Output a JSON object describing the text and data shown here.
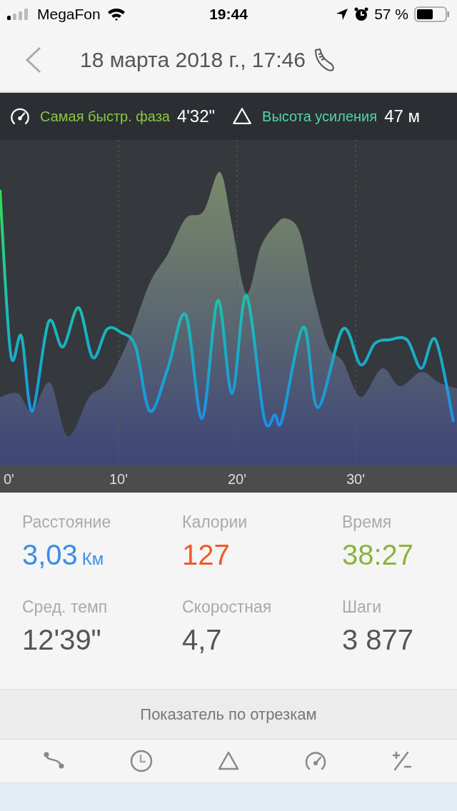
{
  "status_bar": {
    "carrier": "MegaFon",
    "time": "19:44",
    "battery": "57 %"
  },
  "header": {
    "title": "18 марта 2018 г., 17:46"
  },
  "chart_header": [
    {
      "kind": "speed",
      "label": "Самая быстр. фаза",
      "value": "4'32\"",
      "color": "#8cc63f"
    },
    {
      "kind": "elevation",
      "label": "Высота усиления",
      "value": "47 м",
      "color": "#4fd6a8"
    }
  ],
  "chart": {
    "xticks": [
      "0'",
      "10'",
      "20'",
      "30'"
    ]
  },
  "stats": [
    {
      "label": "Расстояние",
      "value": "3,03",
      "unit": "Км",
      "color": "#3a8ee6"
    },
    {
      "label": "Калории",
      "value": "127",
      "color": "#f05a28"
    },
    {
      "label": "Время",
      "value": "38:27",
      "color": "#8db33a"
    },
    {
      "label": "Сред. темп",
      "value": "12'39\"",
      "color": "#555555"
    },
    {
      "label": "Скоростная",
      "value": "4,7",
      "color": "#555555"
    },
    {
      "label": "Шаги",
      "value": "3 877",
      "color": "#555555"
    }
  ],
  "segments_button": "Показатель по отрезкам",
  "segment_tabs": [
    {
      "kind": "route"
    },
    {
      "kind": "time"
    },
    {
      "kind": "elevation"
    },
    {
      "kind": "speed"
    },
    {
      "kind": "plusminus"
    }
  ]
}
